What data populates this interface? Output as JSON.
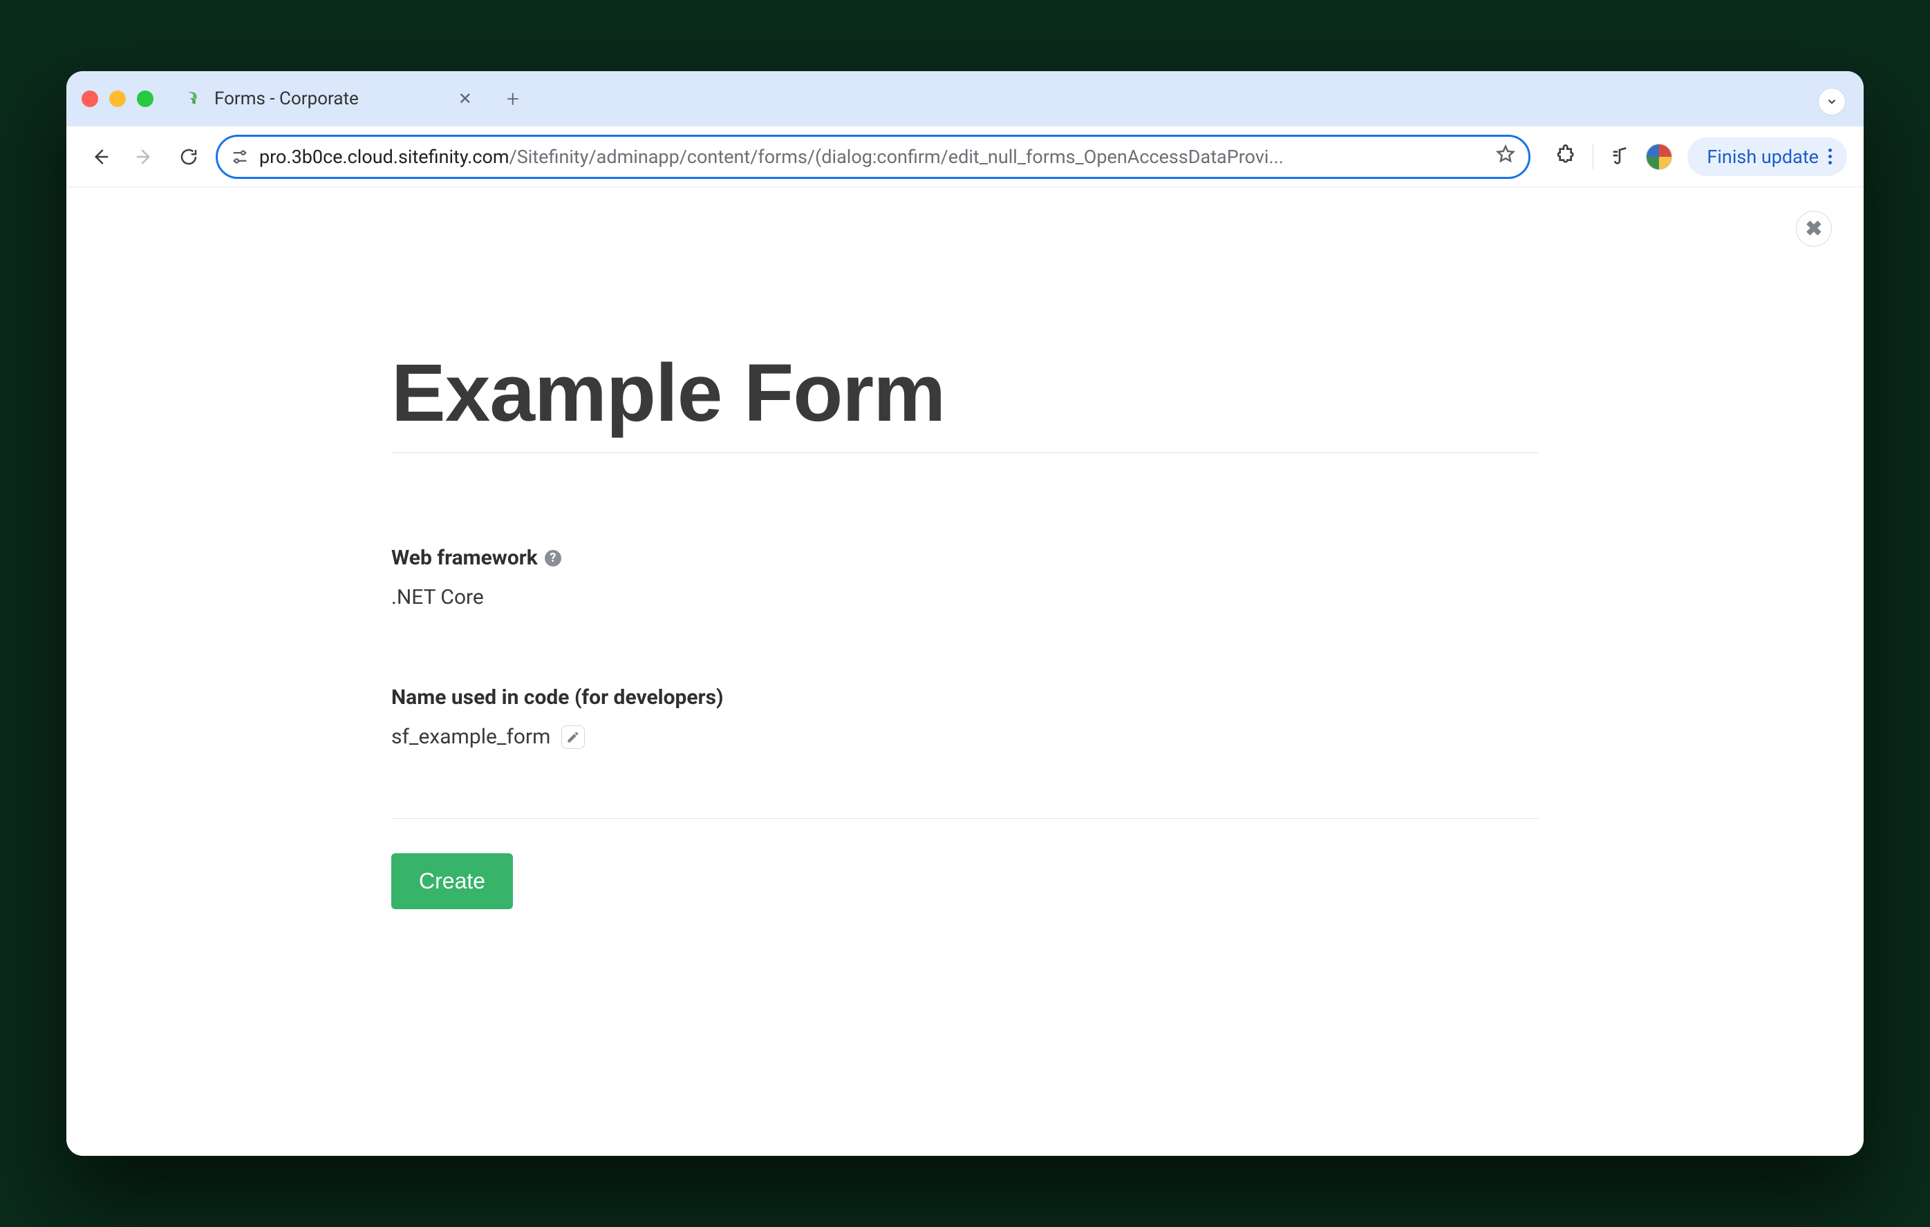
{
  "chrome": {
    "tab_title": "Forms - Corporate",
    "url_host": "pro.3b0ce.cloud.sitefinity.com",
    "url_path": "/Sitefinity/adminapp/content/forms/(dialog:confirm/edit_null_forms_OpenAccessDataProvi...",
    "finish_update_label": "Finish update"
  },
  "dialog": {
    "title_value": "Example Form",
    "web_framework_label": "Web framework",
    "web_framework_value": ".NET Core",
    "code_name_label": "Name used in code (for developers)",
    "code_name_value": "sf_example_form",
    "create_label": "Create"
  }
}
